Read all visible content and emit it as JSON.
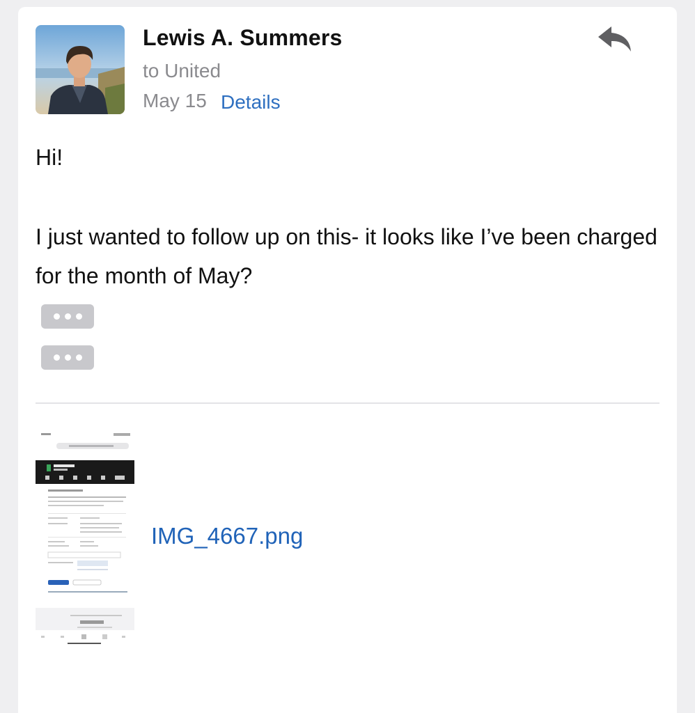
{
  "message": {
    "sender_name": "Lewis A. Summers",
    "to_line": "to United",
    "date": "May 15",
    "details_label": "Details",
    "body": {
      "greeting": "Hi!",
      "paragraph": "I just wanted to follow up on this- it looks like I’ve been charged for the month of May?"
    }
  },
  "attachment": {
    "filename": "IMG_4667.png"
  },
  "icons": {
    "reply": "reply-icon",
    "more": "ellipsis-icon"
  },
  "colors": {
    "link": "#2e6fc0",
    "secondary_text": "#8a8a8e",
    "attachment_link": "#2063b8"
  }
}
